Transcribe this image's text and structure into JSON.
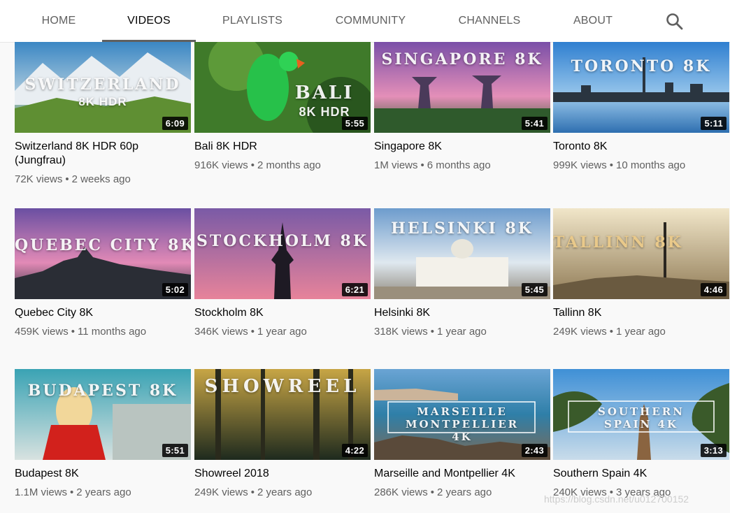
{
  "nav": {
    "tabs": [
      "HOME",
      "VIDEOS",
      "PLAYLISTS",
      "COMMUNITY",
      "CHANNELS",
      "ABOUT"
    ],
    "active_tab": "VIDEOS",
    "search_icon": "search-icon"
  },
  "videos": [
    {
      "title": "Switzerland 8K HDR 60p (Jungfrau)",
      "views": "72K views",
      "age": "2 weeks ago",
      "duration": "6:09",
      "thumb_text": "SWITZERLAND",
      "thumb_badge": "8K HDR"
    },
    {
      "title": "Bali 8K HDR",
      "views": "916K views",
      "age": "2 months ago",
      "duration": "5:55",
      "thumb_text": "BALI",
      "thumb_badge": "8K HDR"
    },
    {
      "title": "Singapore 8K",
      "views": "1M views",
      "age": "6 months ago",
      "duration": "5:41",
      "thumb_text": "SINGAPORE 8K"
    },
    {
      "title": "Toronto 8K",
      "views": "999K views",
      "age": "10 months ago",
      "duration": "5:11",
      "thumb_text": "TORONTO 8K"
    },
    {
      "title": "Quebec City 8K",
      "views": "459K views",
      "age": "11 months ago",
      "duration": "5:02",
      "thumb_text": "QUEBEC CITY 8K"
    },
    {
      "title": "Stockholm 8K",
      "views": "346K views",
      "age": "1 year ago",
      "duration": "6:21",
      "thumb_text": "STOCKHOLM 8K"
    },
    {
      "title": "Helsinki 8K",
      "views": "318K views",
      "age": "1 year ago",
      "duration": "5:45",
      "thumb_text": "HELSINKI 8K"
    },
    {
      "title": "Tallinn 8K",
      "views": "249K views",
      "age": "1 year ago",
      "duration": "4:46",
      "thumb_text": "TALLINN 8K"
    },
    {
      "title": "Budapest 8K",
      "views": "1.1M views",
      "age": "2 years ago",
      "duration": "5:51",
      "thumb_text": "BUDAPEST 8K"
    },
    {
      "title": "Showreel 2018",
      "views": "249K views",
      "age": "2 years ago",
      "duration": "4:22",
      "thumb_text": "SHOWREEL"
    },
    {
      "title": "Marseille and Montpellier 4K",
      "views": "286K views",
      "age": "2 years ago",
      "duration": "2:43",
      "thumb_text": "MARSEILLE MONTPELLIER 4K"
    },
    {
      "title": "Southern Spain 4K",
      "views": "240K views",
      "age": "3 years ago",
      "duration": "3:13",
      "thumb_text": "SOUTHERN SPAIN 4K"
    }
  ],
  "separator": "•",
  "watermark": "https://blog.csdn.net/u012700152",
  "colors": {
    "secondary_text": "#606060",
    "duration_bg": "#000000",
    "active_tab_indicator": "#606060"
  }
}
